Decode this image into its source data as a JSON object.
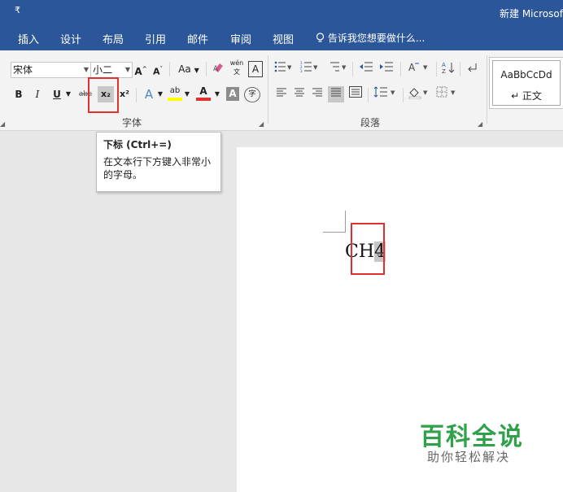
{
  "titlebar": {
    "qat_label": "₹",
    "title": "新建 Microsof"
  },
  "tabs": [
    {
      "label": "插入"
    },
    {
      "label": "设计"
    },
    {
      "label": "布局"
    },
    {
      "label": "引用"
    },
    {
      "label": "邮件"
    },
    {
      "label": "审阅"
    },
    {
      "label": "视图"
    }
  ],
  "tell_me": {
    "icon": "lightbulb-icon",
    "text": "告诉我您想要做什么..."
  },
  "font": {
    "name": "宋体",
    "size": "小二",
    "grow": "A",
    "shrink": "A",
    "case": "Aa",
    "phonetic": "wén 文",
    "border_char": "A",
    "bold": "B",
    "italic": "I",
    "underline": "U",
    "strike": "abc",
    "subscript": "x₂",
    "superscript": "x²",
    "text_effect": "A",
    "highlight": "ab",
    "font_color": "A",
    "char_shading": "A",
    "enclose": "字",
    "group_label": "字体"
  },
  "paragraph": {
    "group_label": "段落"
  },
  "styles": {
    "sample": "AaBbCcDd",
    "name": "↵ 正文"
  },
  "tooltip": {
    "title": "下标 (Ctrl+=)",
    "description": "在文本行下方键入非常小的字母。"
  },
  "document": {
    "text_before": "CH",
    "selected": "4",
    "para_mark": "↵"
  },
  "watermark": {
    "main": "百科全说",
    "sub": "助你轻松解决"
  },
  "colors": {
    "accent": "#2b579a",
    "highlight_box": "#e0312f",
    "watermark": "#2fa14a",
    "font_color_bar": "#e0312f",
    "highlight_bar": "#ffff00"
  }
}
